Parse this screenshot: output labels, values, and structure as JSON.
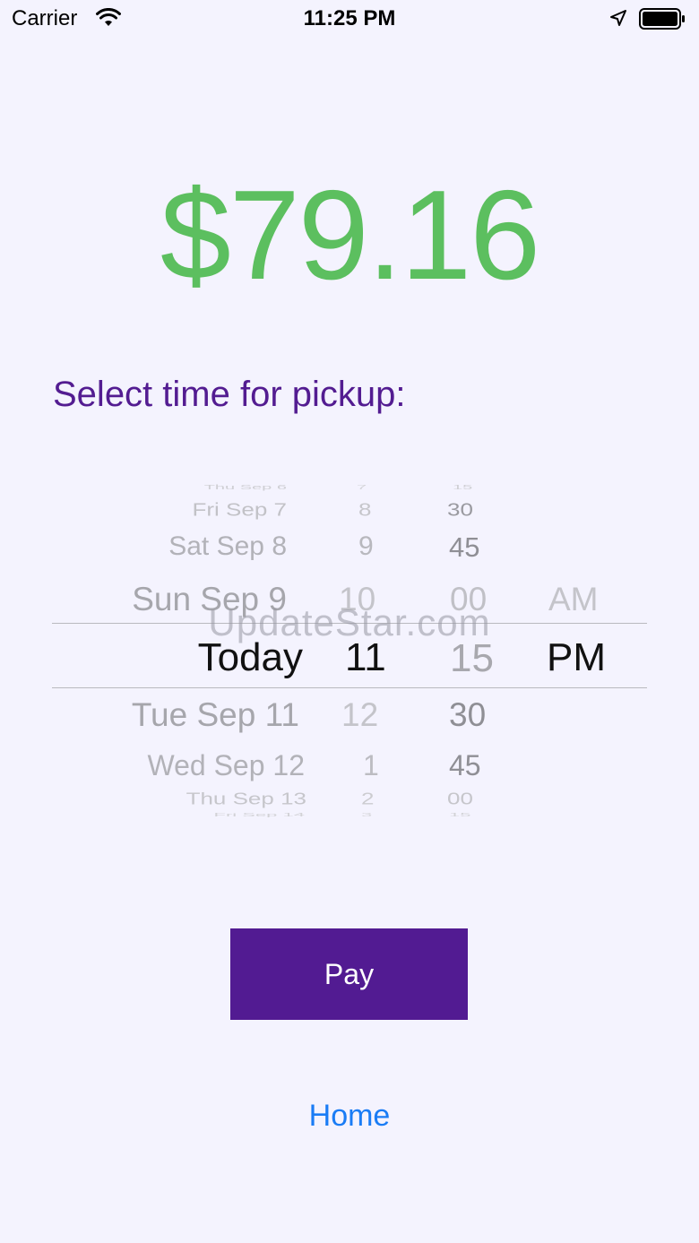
{
  "status_bar": {
    "carrier": "Carrier",
    "time": "11:25 PM",
    "icons": [
      "wifi-icon",
      "location-arrow-icon",
      "battery-icon"
    ]
  },
  "amount": "$79.16",
  "prompt": "Select time for pickup:",
  "picker": {
    "date_column": [
      "Thu Sep 6",
      "Fri Sep 7",
      "Sat Sep 8",
      "Sun Sep 9",
      "Today",
      "Tue Sep 11",
      "Wed Sep 12",
      "Thu Sep 13",
      "Fri Sep 14"
    ],
    "hour_column": [
      "7",
      "8",
      "9",
      "10",
      "11",
      "12",
      "1",
      "2",
      "3"
    ],
    "minute_column": [
      "15",
      "30",
      "45",
      "00",
      "15",
      "30",
      "45",
      "00",
      "15"
    ],
    "period_column": [
      "AM",
      "PM"
    ],
    "selected": {
      "date": "Today",
      "hour": "11",
      "minute": "15",
      "period": "PM"
    }
  },
  "watermark": "UpdateStar.com",
  "pay_button": {
    "label": "Pay"
  },
  "home_link": {
    "label": "Home"
  },
  "colors": {
    "background": "#f4f3fe",
    "amount": "#5cbf5f",
    "prompt": "#531c91",
    "pay_button": "#521b92",
    "link": "#1a7cf5"
  }
}
